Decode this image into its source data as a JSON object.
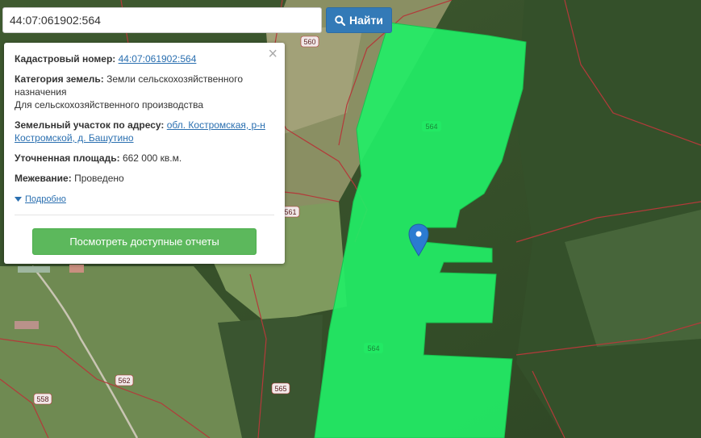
{
  "search": {
    "value": "44:07:061902:564",
    "button_label": "Найти"
  },
  "popup": {
    "cadastral_label": "Кадастровый номер:",
    "cadastral_value": "44:07:061902:564",
    "category_label": "Категория земель:",
    "category_value_line1": "Земли сельскохозяйственного",
    "category_value_line2": "назначения",
    "category_value_line3": "Для сельскохозяйственного производства",
    "address_label": "Земельный участок по адресу:",
    "address_value_line1": "обл. Костромская, р-н",
    "address_value_line2": "Костромской, д. Башутино",
    "area_label": "Уточненная площадь:",
    "area_value": "662 000 кв.м.",
    "survey_label": "Межевание:",
    "survey_value": "Проведено",
    "more_label": "Подробно",
    "report_button_label": "Посмотреть доступные отчеты",
    "close_glyph": "×"
  },
  "map": {
    "parcel_color": "#22ee66",
    "boundary_color": "#b33a3a",
    "parcel_labels": [
      "564",
      "564"
    ],
    "plot_labels": [
      "560",
      "561",
      "562",
      "565",
      "558"
    ]
  }
}
